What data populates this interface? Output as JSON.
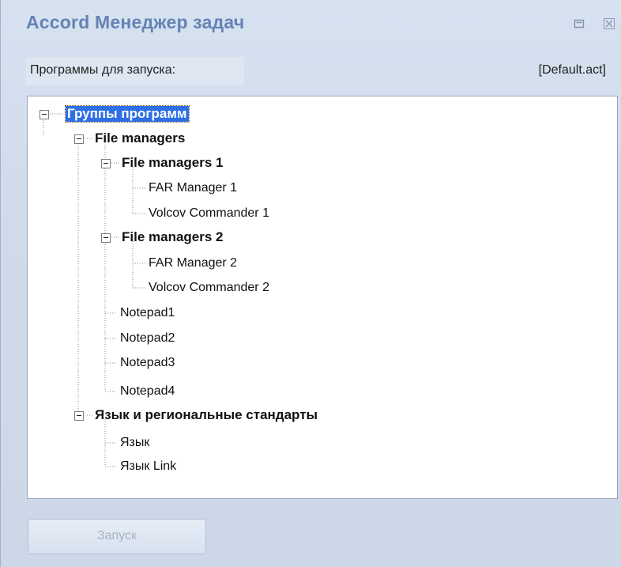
{
  "window": {
    "title": "Accord Менеджер задач",
    "restore_icon": "restore-icon",
    "close_icon": "close-icon"
  },
  "header": {
    "label": "Программы для запуска:",
    "filename": "[Default.act]"
  },
  "tree": {
    "root": "Группы программ",
    "group1": "File managers",
    "group1_1": "File managers 1",
    "item_far1": "FAR Manager 1",
    "item_volcov1": "Volcov Commander 1",
    "group1_2": "File managers 2",
    "item_far2": "FAR Manager 2",
    "item_volcov2": "Volcov Commander 2",
    "item_notepad1": "Notepad1",
    "item_notepad2": "Notepad2",
    "item_notepad3": "Notepad3",
    "item_notepad4": "Notepad4",
    "group2": "Язык и региональные стандарты",
    "item_lang": "Язык",
    "item_lang_link": "Язык Link"
  },
  "footer": {
    "run_label": "Запуск",
    "run_enabled": false
  },
  "colors": {
    "title": "#6583b4",
    "selection": "#2e6fe6",
    "background": "#cfdbea"
  }
}
